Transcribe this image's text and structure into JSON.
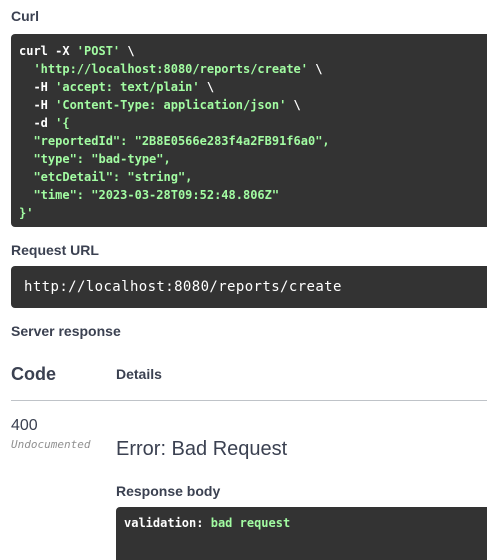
{
  "curl": {
    "label": "Curl",
    "lines": [
      [
        {
          "t": "curl -X ",
          "c": "cmd"
        },
        {
          "t": "'POST'",
          "c": "str"
        },
        {
          "t": " \\",
          "c": "cmd"
        }
      ],
      [
        {
          "t": "  ",
          "c": "cmd"
        },
        {
          "t": "'http://localhost:8080/reports/create'",
          "c": "str"
        },
        {
          "t": " \\",
          "c": "cmd"
        }
      ],
      [
        {
          "t": "  -H ",
          "c": "cmd"
        },
        {
          "t": "'accept: text/plain'",
          "c": "str"
        },
        {
          "t": " \\",
          "c": "cmd"
        }
      ],
      [
        {
          "t": "  -H ",
          "c": "cmd"
        },
        {
          "t": "'Content-Type: application/json'",
          "c": "str"
        },
        {
          "t": " \\",
          "c": "cmd"
        }
      ],
      [
        {
          "t": "  -d ",
          "c": "cmd"
        },
        {
          "t": "'{",
          "c": "str"
        }
      ],
      [
        {
          "t": "  \"reportedId\": \"2B8E0566e283f4a2FB91f6a0\",",
          "c": "str"
        }
      ],
      [
        {
          "t": "  \"type\": \"bad-type\",",
          "c": "str"
        }
      ],
      [
        {
          "t": "  \"etcDetail\": \"string\",",
          "c": "str"
        }
      ],
      [
        {
          "t": "  \"time\": \"2023-03-28T09:52:48.806Z\"",
          "c": "str"
        }
      ],
      [
        {
          "t": "}'",
          "c": "str"
        }
      ]
    ]
  },
  "request_url": {
    "label": "Request URL",
    "value": "http://localhost:8080/reports/create"
  },
  "server_response": {
    "label": "Server response",
    "col_code": "Code",
    "col_details": "Details",
    "status_code": "400",
    "undocumented": "Undocumented",
    "error": "Error: Bad Request",
    "body_label": "Response body",
    "body_key": "validation:",
    "body_value": "bad request"
  },
  "colors": {
    "code_bg": "#333333",
    "string": "#a2fca2",
    "text": "#3b4151"
  }
}
